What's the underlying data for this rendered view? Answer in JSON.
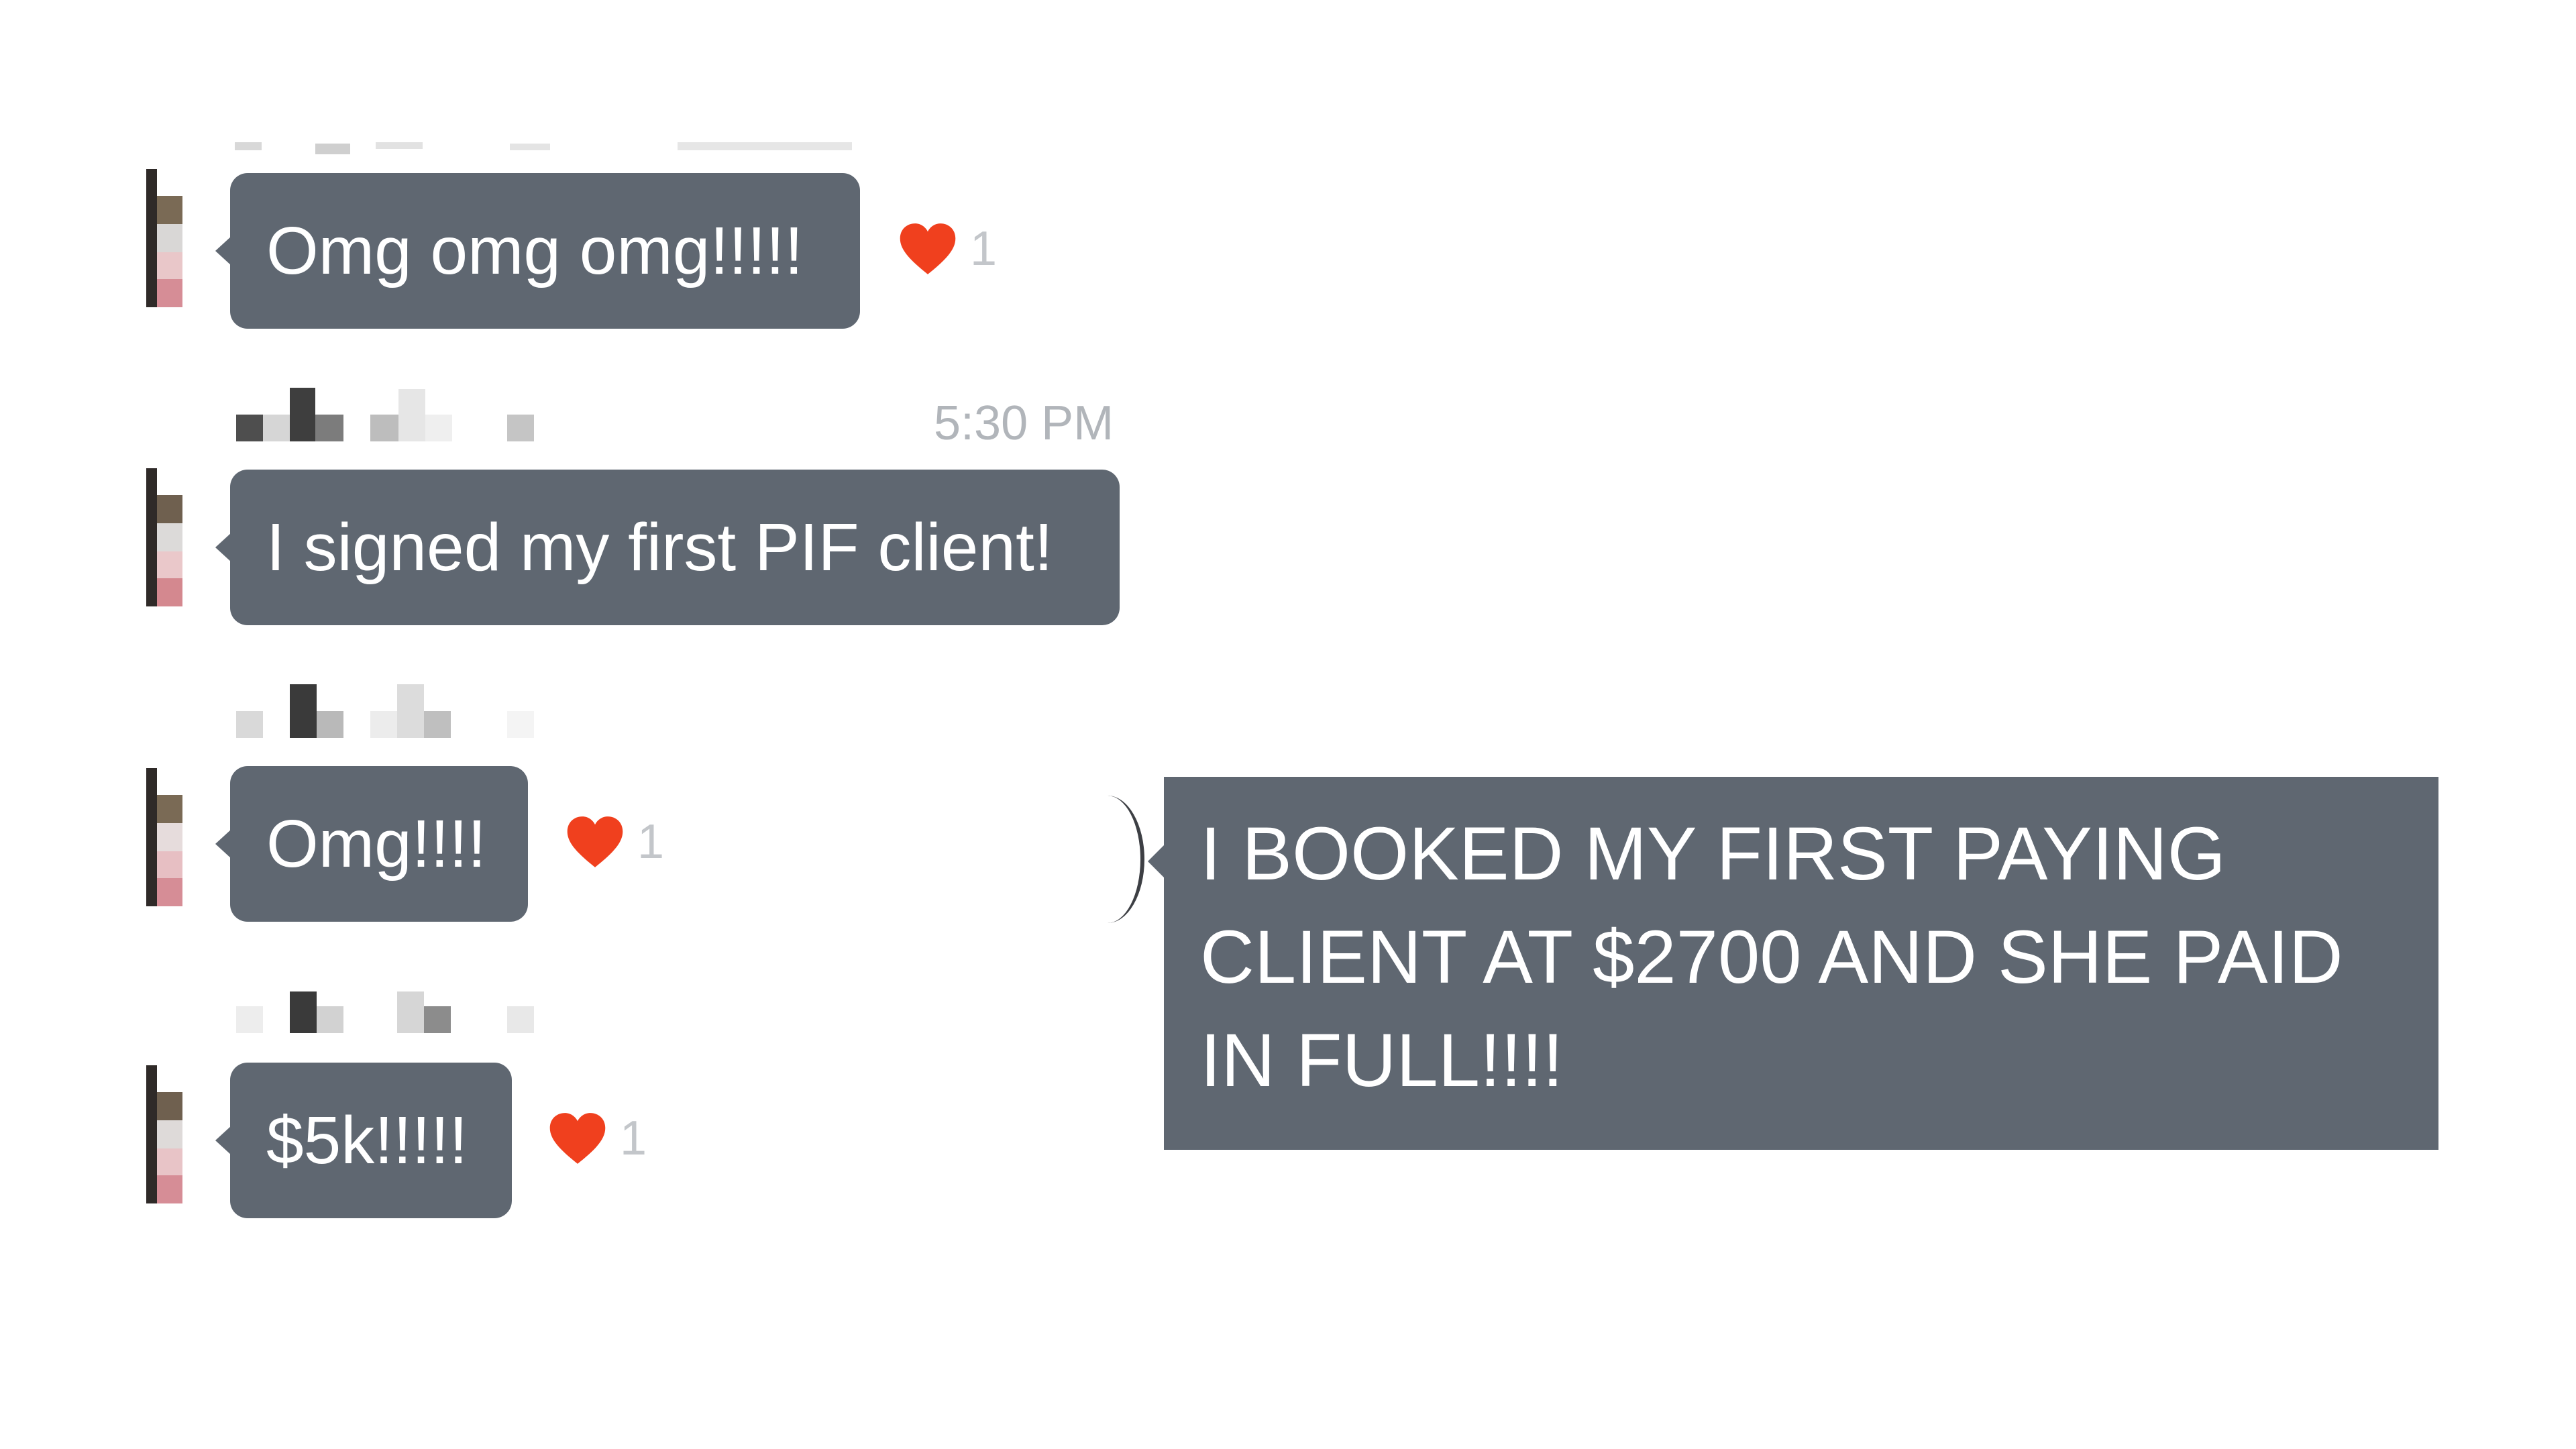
{
  "messages": [
    {
      "text": "Omg omg omg!!!!!",
      "reaction": {
        "icon": "heart-icon",
        "count": "1"
      }
    },
    {
      "timestamp": "5:30 PM",
      "text": "I signed my first PIF client!"
    },
    {
      "text": "Omg!!!!",
      "reaction": {
        "icon": "heart-icon",
        "count": "1"
      }
    },
    {
      "text": "$5k!!!!!",
      "reaction": {
        "icon": "heart-icon",
        "count": "1"
      }
    }
  ],
  "highlight": {
    "text": "I BOOKED MY FIRST PAYING CLIENT AT $2700 AND SHE PAID IN FULL!!!!"
  },
  "colors": {
    "bubble": "#5f6771",
    "heart": "#f0401e",
    "meta_text": "#b1b5ba",
    "background": "#ffffff"
  }
}
